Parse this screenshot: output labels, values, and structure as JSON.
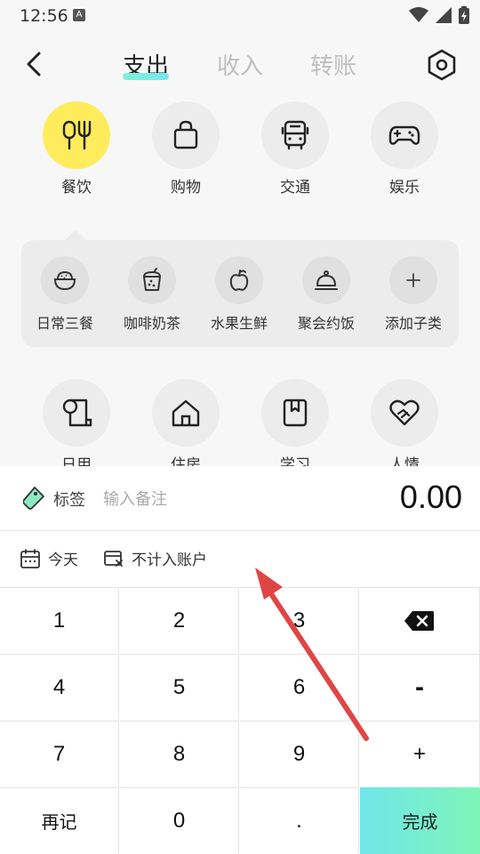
{
  "status": {
    "time": "12:56",
    "notif_icon": "A"
  },
  "header": {
    "tabs": [
      {
        "label": "支出",
        "active": true
      },
      {
        "label": "收入",
        "active": false
      },
      {
        "label": "转账",
        "active": false
      }
    ]
  },
  "categories": {
    "row1": [
      {
        "label": "餐饮",
        "icon": "food-icon",
        "active": true
      },
      {
        "label": "购物",
        "icon": "shopping-bag-icon"
      },
      {
        "label": "交通",
        "icon": "bus-icon"
      },
      {
        "label": "娱乐",
        "icon": "gamepad-icon"
      }
    ],
    "sub": [
      {
        "label": "日常三餐",
        "icon": "rice-bowl-icon"
      },
      {
        "label": "咖啡奶茶",
        "icon": "bubble-tea-icon"
      },
      {
        "label": "水果生鲜",
        "icon": "apple-icon"
      },
      {
        "label": "聚会约饭",
        "icon": "dish-cover-icon"
      },
      {
        "label": "添加子类",
        "icon": "plus-icon"
      }
    ],
    "row2": [
      {
        "label": "日用",
        "icon": "paper-roll-icon"
      },
      {
        "label": "住房",
        "icon": "house-icon"
      },
      {
        "label": "学习",
        "icon": "book-icon"
      },
      {
        "label": "人情",
        "icon": "heart-hand-icon"
      }
    ]
  },
  "entry": {
    "tag_label": "标签",
    "note_placeholder": "输入备注",
    "amount": "0.00",
    "date_label": "今天",
    "account_label": "不计入账户"
  },
  "keypad": {
    "k1": "1",
    "k2": "2",
    "k3": "3",
    "k4": "4",
    "k5": "5",
    "k6": "6",
    "k7": "7",
    "k8": "8",
    "k9": "9",
    "minus": "-",
    "plus": "+",
    "again": "再记",
    "zero": "0",
    "dot": ".",
    "done": "完成"
  },
  "colors": {
    "accent_yellow": "#ffec5c",
    "done_gradient_start": "#6fe6ea",
    "done_gradient_end": "#7ef5b6",
    "arrow": "#e04545"
  }
}
